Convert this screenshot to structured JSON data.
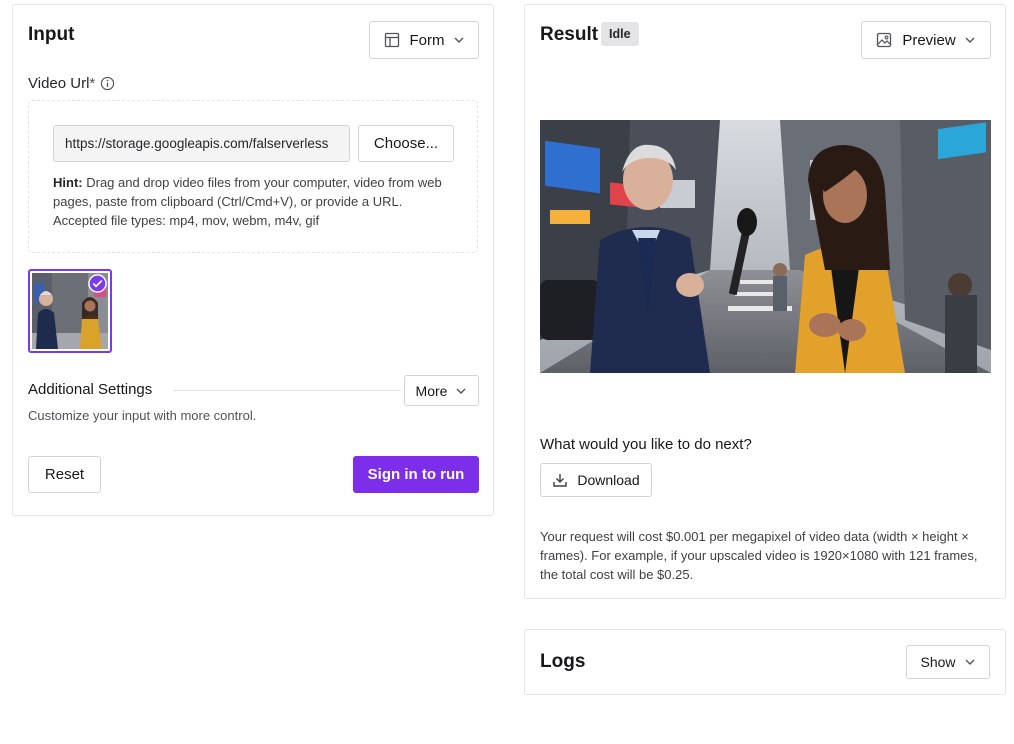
{
  "input_panel": {
    "title": "Input",
    "view_select": {
      "label": "Form",
      "icon": "form-icon"
    },
    "video_url": {
      "label": "Video Url",
      "required_mark": "*",
      "value": "https://storage.googleapis.com/falserverless",
      "placeholder": "",
      "choose_label": "Choose...",
      "hint_bold": "Hint:",
      "hint_text": " Drag and drop video files from your computer, video from web pages, paste from clipboard (Ctrl/Cmd+V), or provide a URL. Accepted file types: mp4, mov, webm, m4v, gif"
    },
    "thumbnail": {
      "selected": true
    },
    "additional_settings": {
      "title": "Additional Settings",
      "more_label": "More",
      "description": "Customize your input with more control."
    },
    "reset_label": "Reset",
    "run_label": "Sign in to run"
  },
  "result_panel": {
    "title": "Result",
    "status_badge": "Idle",
    "view_select": {
      "label": "Preview",
      "icon": "image-icon"
    },
    "next_prompt": "What would you like to do next?",
    "download_label": "Download",
    "cost_text": "Your request will cost $0.001 per megapixel of video data (width × height × frames). For example, if your upscaled video is 1920×1080 with 121 frames, the total cost will be $0.25."
  },
  "logs_panel": {
    "title": "Logs",
    "show_label": "Show"
  },
  "colors": {
    "accent": "#7c2ee8",
    "border": "#e4e4e7",
    "badge_bg": "#e4e4e7"
  }
}
